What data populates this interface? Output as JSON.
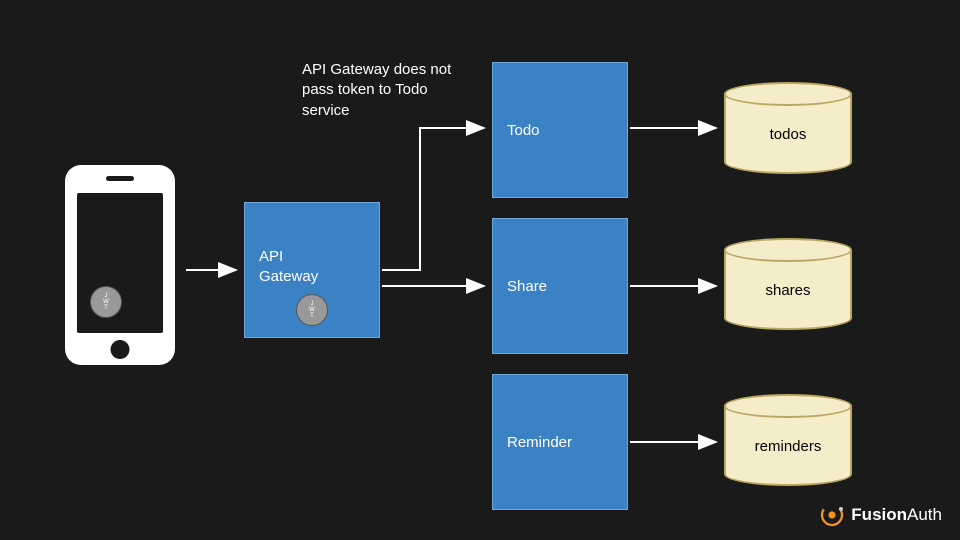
{
  "annotation": "API Gateway does not pass token to Todo service",
  "jwt_label_j": "J",
  "jwt_label_w": "W",
  "jwt_label_t": "T",
  "gateway": {
    "label_line1": "API",
    "label_line2": "Gateway"
  },
  "services": {
    "todo": "Todo",
    "share": "Share",
    "reminder": "Reminder"
  },
  "databases": {
    "todos": "todos",
    "shares": "shares",
    "reminders": "reminders"
  },
  "logo": {
    "brand_bold": "Fusion",
    "brand_thin": "Auth"
  },
  "colors": {
    "background": "#1a1a1a",
    "box": "#3b82c4",
    "cylinder": "#f5ecc9",
    "jwt": "#999"
  }
}
